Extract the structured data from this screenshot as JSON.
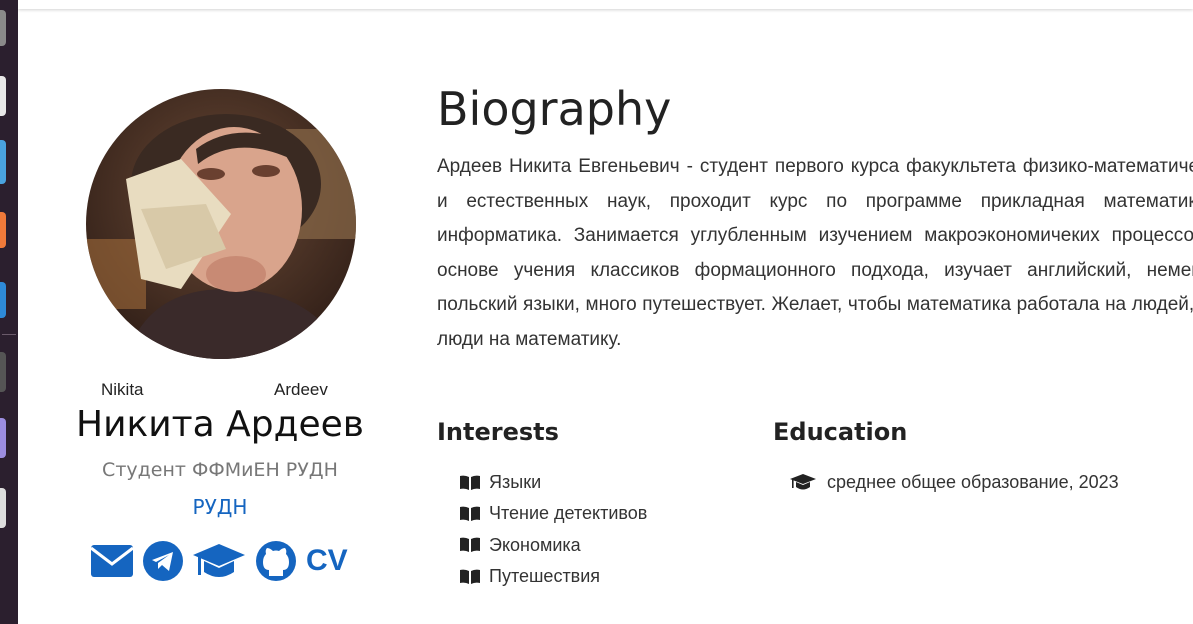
{
  "profile": {
    "first_name": "Nikita",
    "last_name": "Ardeev",
    "full_name": "Никита Ардеев",
    "role": "Студент ФФМиЕН РУДН",
    "organization": "РУДН",
    "social": {
      "email_icon": "envelope-icon",
      "telegram_icon": "telegram-icon",
      "scholar_icon": "graduation-cap-icon",
      "github_icon": "github-icon",
      "cv_label": "CV"
    }
  },
  "biography": {
    "title": "Biography",
    "text": "Ардеев Никита Евгеньевич - студент первого курса факукльтета физико-математических и естественных наук, проходит курс по программе прикладная математика и информатика. Занимается углубленным изучением макроэкономичеких процессов на основе учения классиков формационного подхода, изучает английский, немецкий, польский языки, много путешествует. Желает, чтобы математика работала на людей, а не люди на математику."
  },
  "interests": {
    "title": "Interests",
    "icon": "book-icon",
    "items": [
      "Языки",
      "Чтение детективов",
      "Экономика",
      "Путешествия"
    ]
  },
  "education": {
    "title": "Education",
    "icon": "graduation-cap-icon",
    "items": [
      "среднее общее образование, 2023"
    ]
  },
  "colors": {
    "accent": "#1565c0",
    "text": "#333333",
    "muted": "#777777"
  }
}
